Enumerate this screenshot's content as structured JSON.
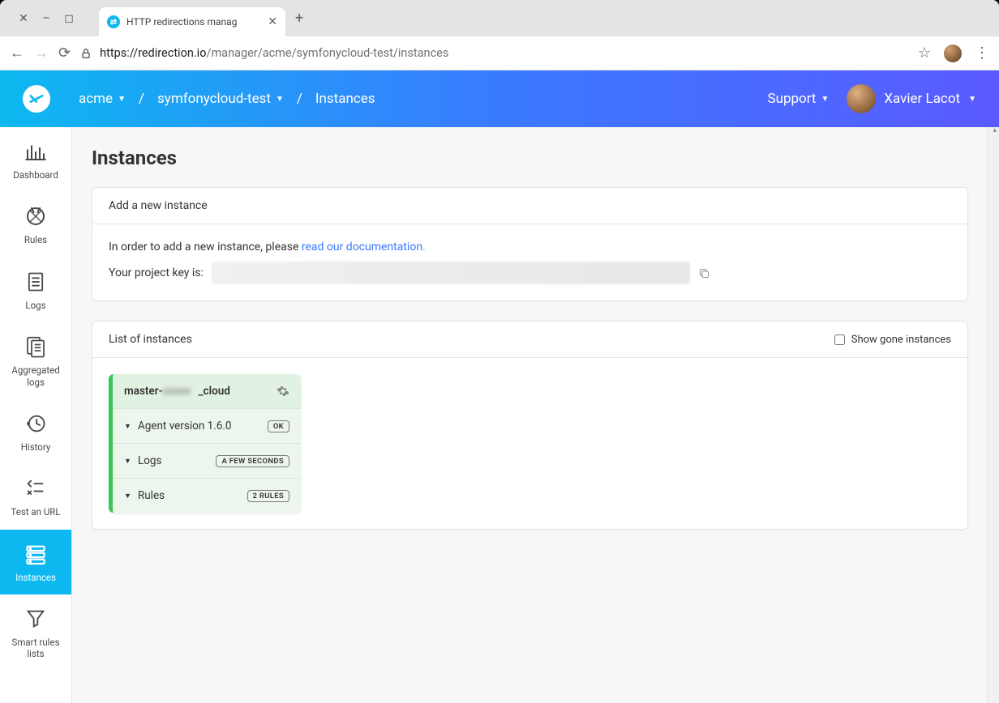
{
  "browser": {
    "tab_title": "HTTP redirections manag",
    "url_host": "https://redirection.io",
    "url_path": "/manager/acme/symfonycloud-test/instances"
  },
  "header": {
    "crumb1": "acme",
    "crumb2": "symfonycloud-test",
    "crumb3": "Instances",
    "support": "Support",
    "user": "Xavier Lacot"
  },
  "sidebar": {
    "items": [
      {
        "label": "Dashboard"
      },
      {
        "label": "Rules"
      },
      {
        "label": "Logs"
      },
      {
        "label": "Aggregated logs"
      },
      {
        "label": "History"
      },
      {
        "label": "Test an URL"
      },
      {
        "label": "Instances"
      },
      {
        "label": "Smart rules lists"
      }
    ]
  },
  "page": {
    "title": "Instances",
    "add_instance_header": "Add a new instance",
    "add_instance_text_pre": "In order to add a new instance, please ",
    "add_instance_link": "read our documentation.",
    "project_key_label": "Your project key is:",
    "list_header": "List of instances",
    "show_gone_label": "Show gone instances"
  },
  "instance": {
    "name_pre": "master-",
    "name_post": "_cloud",
    "rows": [
      {
        "label": "Agent version 1.6.0",
        "badge": "OK"
      },
      {
        "label": "Logs",
        "badge": "A FEW SECONDS"
      },
      {
        "label": "Rules",
        "badge": "2 RULES"
      }
    ]
  }
}
